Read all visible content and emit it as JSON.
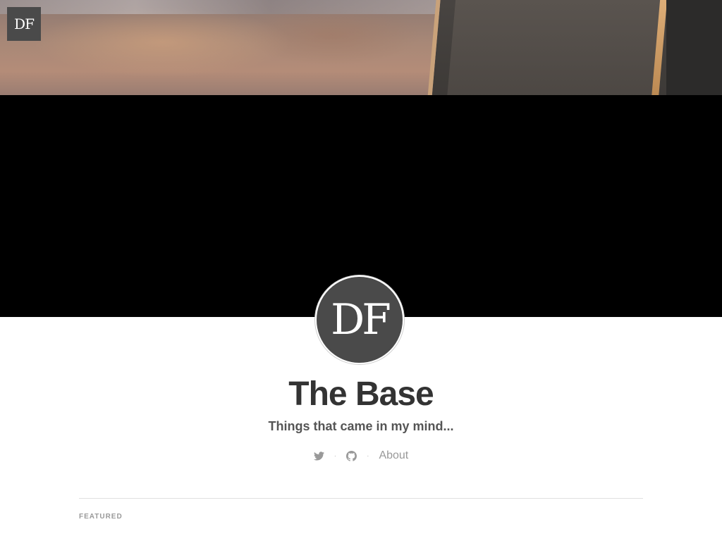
{
  "header": {
    "logo_text": "DF",
    "cover_colors": {
      "background": "#000000"
    }
  },
  "profile": {
    "avatar_text": "DF",
    "title": "The Base",
    "description": "Things that came in my mind..."
  },
  "nav": {
    "items": [
      {
        "icon": "twitter-icon"
      },
      {
        "icon": "github-icon"
      },
      {
        "label": "About"
      }
    ],
    "separator": "·"
  },
  "main": {
    "section_label": "FEATURED"
  },
  "colors": {
    "text_primary": "#333333",
    "text_muted": "#999999",
    "avatar_bg": "#4a4a4a"
  }
}
